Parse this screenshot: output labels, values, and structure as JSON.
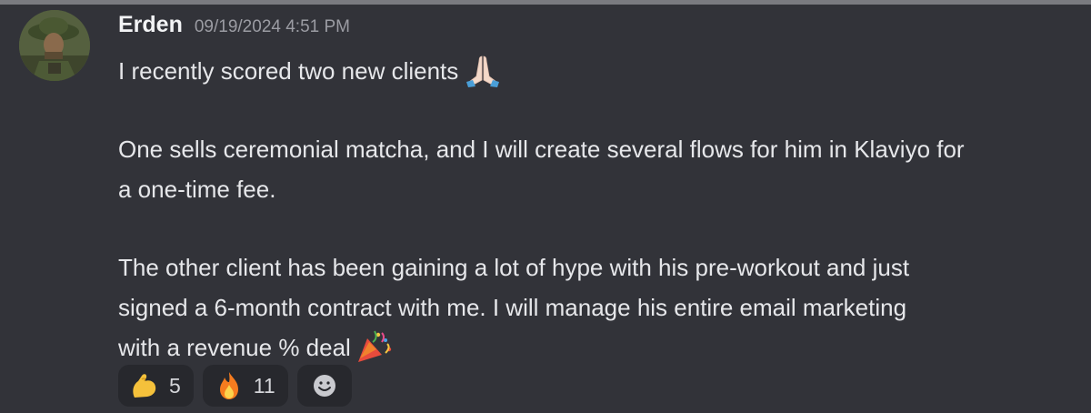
{
  "message": {
    "author": "Erden",
    "timestamp": "09/19/2024 4:51 PM",
    "avatar_icon": "avatar-soldier-icon",
    "lines": [
      "I recently scored two new clients",
      "",
      "One sells ceremonial matcha, and I will create several flows for him in Klaviyo for",
      "a one-time fee.",
      "",
      "The other client has been gaining a lot of hype with his pre-workout and just",
      "signed a 6-month contract with me. I will manage his entire email marketing",
      "with a revenue % deal"
    ],
    "inline_emojis": [
      "folded-hands-emoji",
      "party-popper-emoji"
    ]
  },
  "reactions": [
    {
      "emoji": "flexed-biceps-emoji",
      "count": "5"
    },
    {
      "emoji": "fire-emoji",
      "count": "11"
    },
    {
      "emoji": "add-reaction-icon",
      "count": ""
    }
  ],
  "colors": {
    "background": "#323339",
    "username": "#f2f3f5",
    "timestamp": "#9b9ca3",
    "text": "#e6e7ea",
    "reaction_bg": "#27282d"
  }
}
